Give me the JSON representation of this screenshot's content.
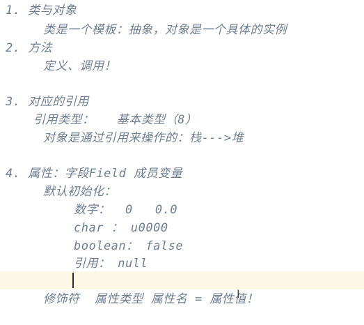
{
  "notes": {
    "lines": [
      "1. 类与对象",
      "类是一个模板：抽象，对象是一个具体的实例",
      "2. 方法",
      "定义、调用！",
      "3. 对应的引用",
      "引用类型：   基本类型（8）",
      "对象是通过引用来操作的：栈--->堆",
      "4. 属性：字段Field 成员变量",
      "默认初始化：",
      "数字：  0   0.0",
      "char ： u0000",
      "boolean： false",
      "引用： null",
      "修饰符  属性类型 属性名 = 属性值！"
    ]
  },
  "editor": {
    "current_line_highlight": "#fdf7e6",
    "text_color": "#6f7f92",
    "cursor_icon": "text-cursor-icon"
  }
}
